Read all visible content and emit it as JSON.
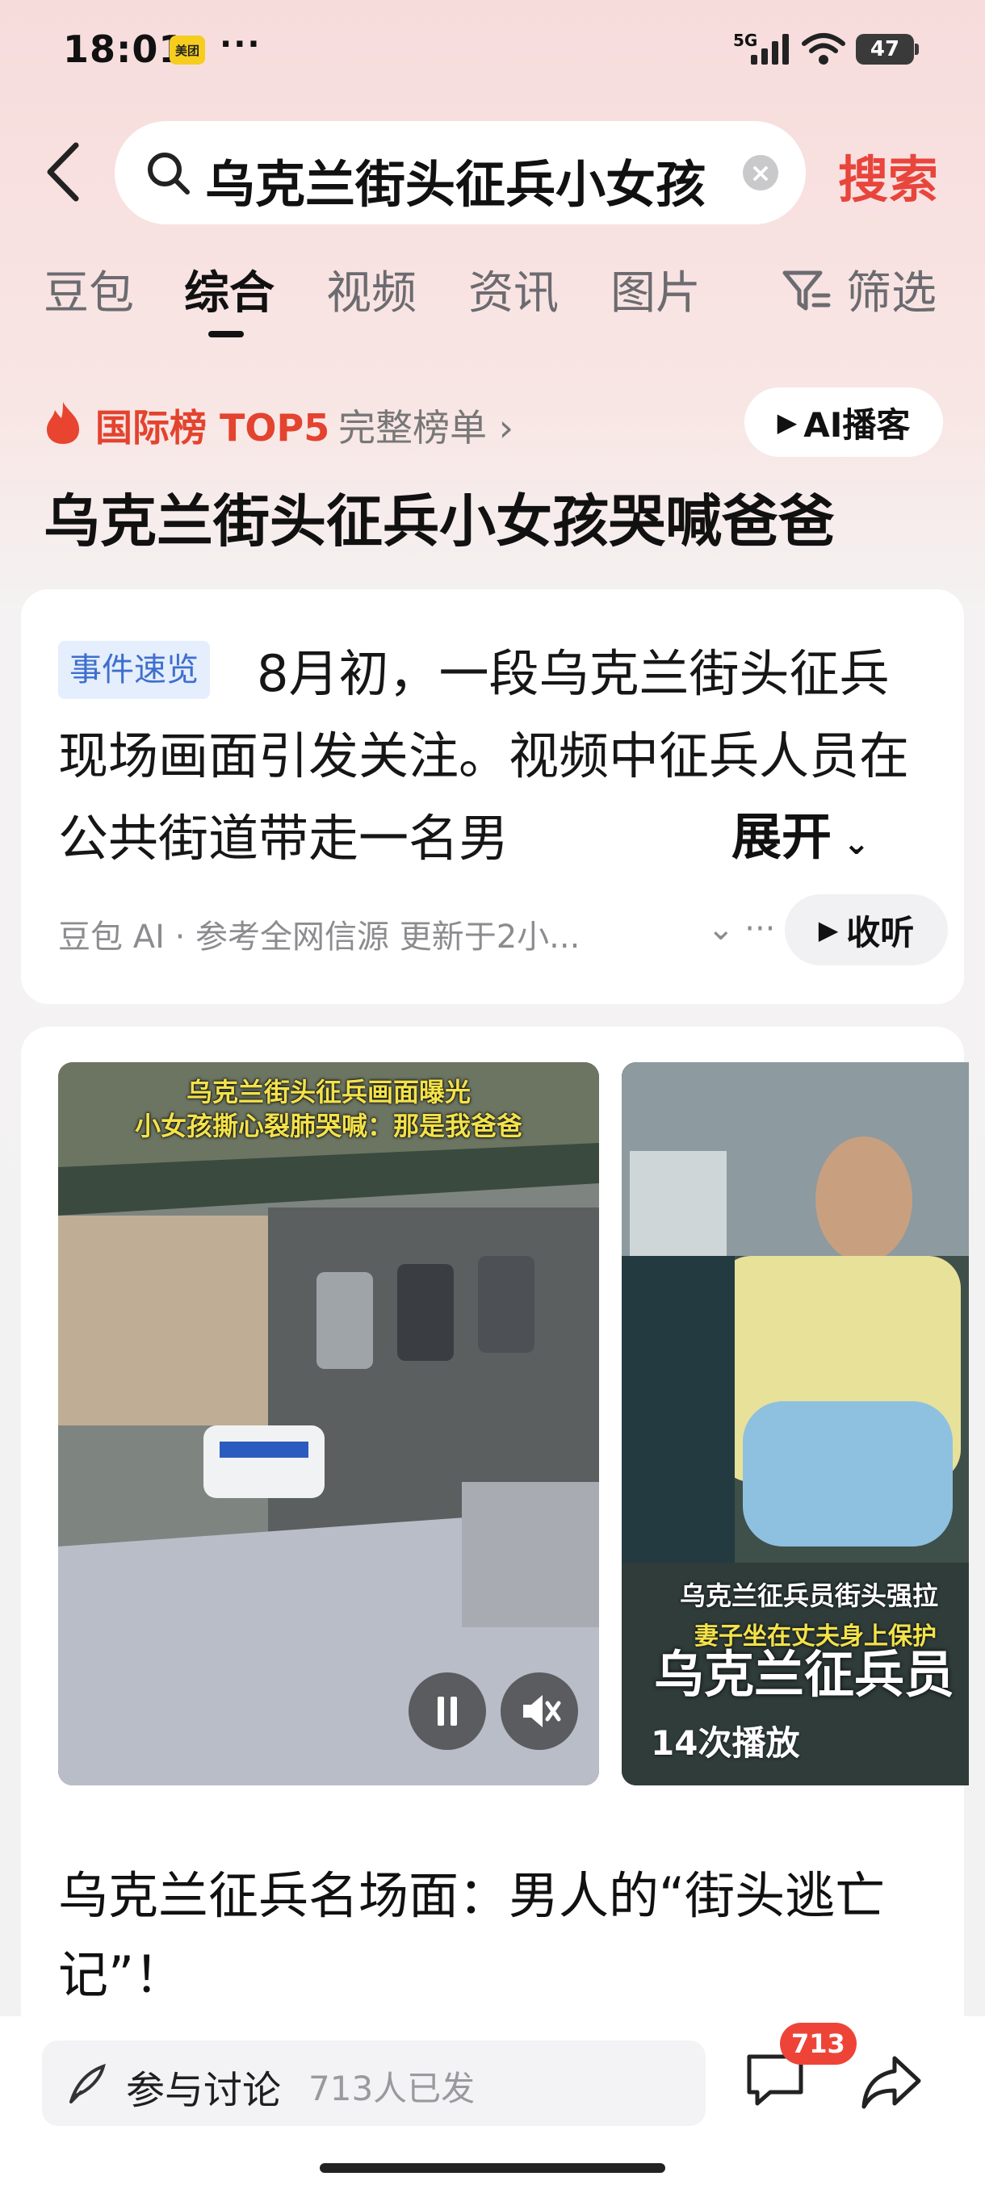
{
  "status_bar": {
    "time": "18:01",
    "app_badge": "美团",
    "dots": "···",
    "network": "5G",
    "battery": "47"
  },
  "search": {
    "query": "乌克兰街头征兵小女孩",
    "button_label": "搜索"
  },
  "tabs": [
    {
      "label": "豆包"
    },
    {
      "label": "综合"
    },
    {
      "label": "视频"
    },
    {
      "label": "资讯"
    },
    {
      "label": "图片"
    },
    {
      "label": "筛选"
    }
  ],
  "ranking": {
    "label": "国际榜 TOP5",
    "link": "完整榜单 ›",
    "ai_button": "AI播客"
  },
  "headline": "乌克兰街头征兵小女孩哭喊爸爸",
  "summary_card": {
    "tag": "事件速览",
    "text": "8月初，一段乌克兰街头征兵现场画面引发关注。视频中征兵人员在公共街道带走一名男",
    "expand_label": "展开",
    "source": "豆包 AI · 参考全网信源 更新于2小...",
    "listen_label": "收听"
  },
  "videos": [
    {
      "caption_line1": "乌克兰街头征兵画面曝光",
      "caption_line2": "小女孩撕心裂肺哭喊：那是我爸爸"
    },
    {
      "caption_a": "乌克兰征兵员街头强拉",
      "caption_b": "妻子坐在丈夫身上保护",
      "caption_c": "乌克兰征兵员",
      "play_count": "14次播放"
    }
  ],
  "article_title": "乌克兰征兵名场面：男人的“街头逃亡记”！",
  "bottom_bar": {
    "discuss_label": "参与讨论",
    "discuss_count": "713人已发",
    "comment_badge": "713"
  },
  "colors": {
    "accent_red": "#e8453c",
    "tag_blue": "#3e6fce",
    "tag_bg": "#e5eefc"
  }
}
